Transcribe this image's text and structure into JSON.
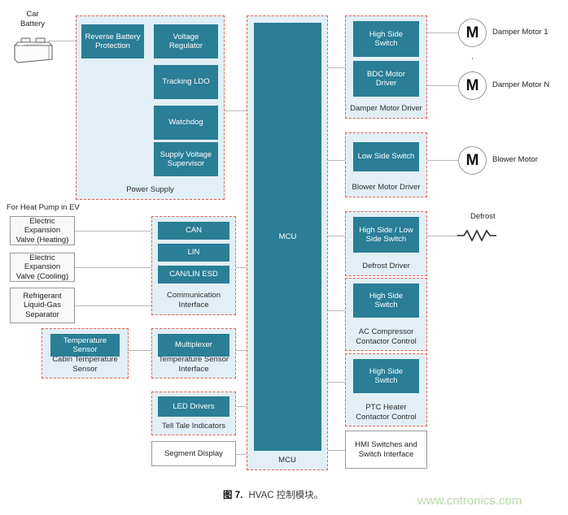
{
  "figure": {
    "caption_prefix": "图 7.",
    "caption_text": "HVAC 控制模块。",
    "watermark": "www.cntronics.com"
  },
  "colors": {
    "chip_teal": "#2A7E96",
    "group_fill": "#E2EFF6",
    "group_border": "#E8614D",
    "wire": "#b9b9b9",
    "extbox_fill": "#F8F8F8",
    "watermark": "#B9D9A8"
  },
  "left_column": {
    "battery": {
      "label_line1": "Car",
      "label_line2": "Battery",
      "icon": "car-battery-icon"
    },
    "section_note": "For Heat Pump in EV",
    "external_inputs": [
      {
        "id": "eev-heating",
        "text": "Electric Expansion\nValve (Heating)"
      },
      {
        "id": "eev-cooling",
        "text": "Electric Expansion\nValve (Cooling)"
      },
      {
        "id": "refrigerant-separator",
        "text": "Refrigerant\nLiquid-Gas\nSeparator"
      }
    ],
    "cabin_temp_group": {
      "label": "Cabin Temperature\nSensor",
      "chips": [
        {
          "id": "temperature-sensor",
          "text": "Temperature\nSensor"
        }
      ]
    }
  },
  "power_supply": {
    "label": "Power Supply",
    "chips": [
      {
        "id": "reverse-battery-protection",
        "text": "Reverse Battery\nProtection"
      },
      {
        "id": "voltage-regulator",
        "text": "Voltage\nRegulator"
      },
      {
        "id": "tracking-ldo",
        "text": "Tracking LDO"
      },
      {
        "id": "watchdog",
        "text": "Watchdog"
      },
      {
        "id": "supply-voltage-supervisor",
        "text": "Supply Voltage\nSupervisor"
      }
    ]
  },
  "middle_column": {
    "communication_interface": {
      "label": "Communication\nInterface",
      "chips": [
        {
          "id": "can",
          "text": "CAN"
        },
        {
          "id": "lin",
          "text": "LIN"
        },
        {
          "id": "can-lin-esd",
          "text": "CAN/LIN ESD"
        }
      ]
    },
    "temperature_sensor_interface": {
      "label": "Temperature Sensor\nInterface",
      "chips": [
        {
          "id": "multiplexer",
          "text": "Multiplexer"
        }
      ]
    },
    "tell_tale_indicators": {
      "label": "Tell Tale Indicators",
      "chips": [
        {
          "id": "led-drivers",
          "text": "LED Drivers"
        }
      ]
    },
    "segment_display": {
      "text": "Segment Display"
    }
  },
  "mcu": {
    "label": "MCU",
    "chip_text": "MCU"
  },
  "right_column": {
    "damper_motor_driver": {
      "label": "Damper Motor Driver",
      "chips": [
        {
          "id": "high-side-switch",
          "text": "High Side\nSwitch"
        },
        {
          "id": "bdc-motor-driver",
          "text": "BDC Motor\nDriver"
        }
      ]
    },
    "blower_motor_driver": {
      "label": "Blower Motor Driver",
      "chips": [
        {
          "id": "low-side-switch",
          "text": "Low Side Switch"
        }
      ]
    },
    "defrost_driver": {
      "label": "Defrost Driver",
      "chips": [
        {
          "id": "high-low-side-switch",
          "text": "High Side / Low\nSide Switch"
        }
      ]
    },
    "ac_compressor_contactor_control": {
      "label": "AC Compressor\nContactor Control",
      "chips": [
        {
          "id": "high-side-switch-ac",
          "text": "High Side\nSwitch"
        }
      ]
    },
    "ptc_heater_contactor_control": {
      "label": "PTC Heater\nContactor Control",
      "chips": [
        {
          "id": "high-side-switch-ptc",
          "text": "High Side\nSwitch"
        }
      ]
    },
    "hmi_switches": {
      "text": "HMI Switches and\nSwitch Interface"
    }
  },
  "loads": {
    "damper_motor_1": {
      "symbol": "M",
      "label": "Damper Motor 1"
    },
    "damper_motor_n": {
      "symbol": "M",
      "label": "Damper Motor N"
    },
    "blower_motor": {
      "symbol": "M",
      "label": "Blower Motor"
    },
    "defrost": {
      "label": "Defrost",
      "symbol": "resistor"
    },
    "ellipsis": "."
  }
}
